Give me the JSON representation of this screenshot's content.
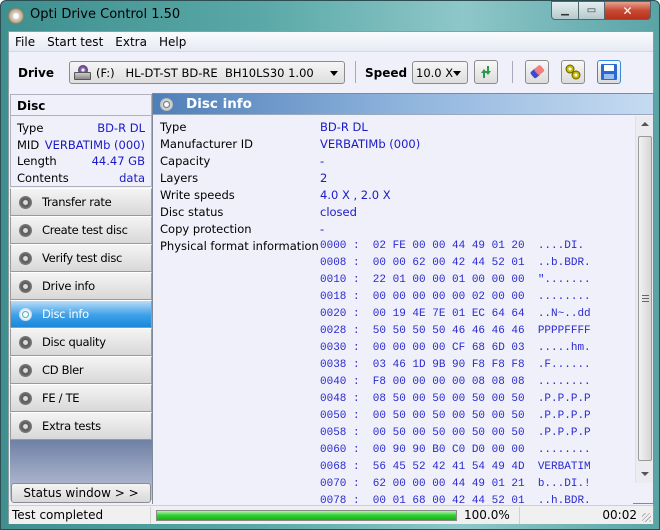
{
  "window": {
    "title": "Opti Drive Control 1.50",
    "controls": {
      "minimize": "▁",
      "maximize": "▭",
      "close": "✕"
    }
  },
  "menu": [
    "File",
    "Start test",
    "Extra",
    "Help"
  ],
  "toolbar": {
    "drive_label": "Drive",
    "drive_value": "(F:)   HL-DT-ST BD-RE  BH10LS30 1.00",
    "speed_label": "Speed",
    "speed_value": "10.0 X",
    "icons": [
      "refresh-icon",
      "eraser-icon",
      "settings-icon",
      "save-icon"
    ]
  },
  "disc_panel": {
    "heading": "Disc",
    "fields": [
      {
        "label": "Type",
        "value": "BD-R DL"
      },
      {
        "label": "MID",
        "value": "VERBATIMb (000)"
      },
      {
        "label": "Length",
        "value": "44.47 GB"
      },
      {
        "label": "Contents",
        "value": "data"
      }
    ]
  },
  "nav": [
    {
      "label": "Transfer rate",
      "active": false
    },
    {
      "label": "Create test disc",
      "active": false
    },
    {
      "label": "Verify test disc",
      "active": false
    },
    {
      "label": "Drive info",
      "active": false
    },
    {
      "label": "Disc info",
      "active": true
    },
    {
      "label": "Disc quality",
      "active": false
    },
    {
      "label": "CD Bler",
      "active": false
    },
    {
      "label": "FE / TE",
      "active": false
    },
    {
      "label": "Extra tests",
      "active": false
    }
  ],
  "status_button": "Status window > >",
  "main": {
    "heading": "Disc info",
    "fields": [
      {
        "label": "Type",
        "value": "BD-R DL"
      },
      {
        "label": "Manufacturer ID",
        "value": "VERBATIMb (000)"
      },
      {
        "label": "Capacity",
        "value": "-"
      },
      {
        "label": "Layers",
        "value": "2"
      },
      {
        "label": "Write speeds",
        "value": "4.0 X , 2.0 X"
      },
      {
        "label": "Disc status",
        "value": "closed"
      },
      {
        "label": "Copy protection",
        "value": "-"
      },
      {
        "label": "Physical format information",
        "value": ""
      }
    ],
    "hex_rows": [
      "0000 :  02 FE 00 00 44 49 01 20  ....DI.",
      "0008 :  00 00 62 00 42 44 52 01  ..b.BDR.",
      "0010 :  22 01 00 00 01 00 00 00  \".......",
      "0018 :  00 00 00 00 00 02 00 00  ........",
      "0020 :  00 19 4E 7E 01 EC 64 64  ..N~..dd",
      "0028 :  50 50 50 50 46 46 46 46  PPPPFFFF",
      "0030 :  00 00 00 00 CF 68 6D 03  .....hm.",
      "0038 :  03 46 1D 9B 90 F8 F8 F8  .F......",
      "0040 :  F8 00 00 00 00 08 08 08  ........",
      "0048 :  08 50 00 50 00 50 00 50  .P.P.P.P",
      "0050 :  00 50 00 50 00 50 00 50  .P.P.P.P",
      "0058 :  00 50 00 50 00 50 00 50  .P.P.P.P",
      "0060 :  00 90 90 B0 C0 D0 00 00  ........",
      "0068 :  56 45 52 42 41 54 49 4D  VERBATIM",
      "0070 :  62 00 00 00 44 49 01 21  b...DI.!",
      "0078 :  00 01 68 00 42 44 52 01  ..h.BDR."
    ]
  },
  "statusbar": {
    "text": "Test completed",
    "progress_percent": 100.0,
    "progress_label": "100.0%",
    "elapsed": "00:02"
  }
}
